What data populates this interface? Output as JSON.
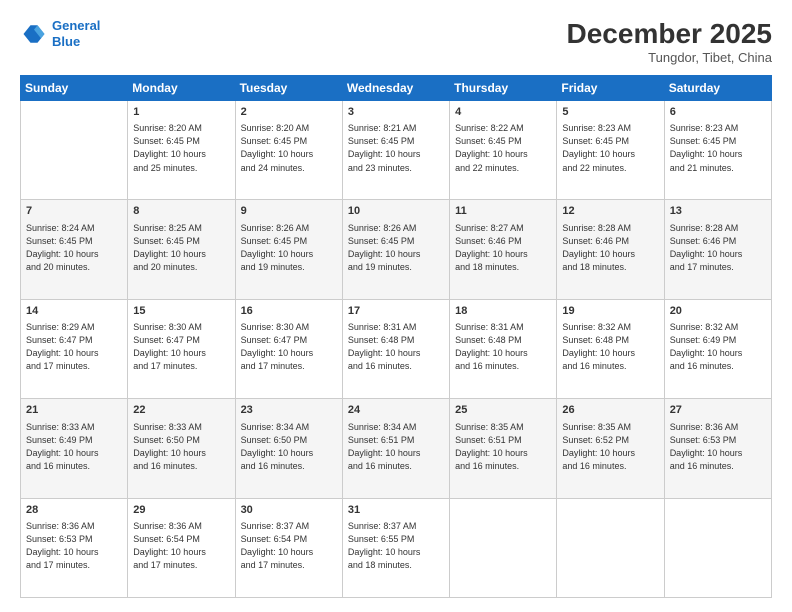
{
  "header": {
    "logo_line1": "General",
    "logo_line2": "Blue",
    "month": "December 2025",
    "location": "Tungdor, Tibet, China"
  },
  "days_of_week": [
    "Sunday",
    "Monday",
    "Tuesday",
    "Wednesday",
    "Thursday",
    "Friday",
    "Saturday"
  ],
  "weeks": [
    [
      {
        "day": "",
        "info": ""
      },
      {
        "day": "1",
        "info": "Sunrise: 8:20 AM\nSunset: 6:45 PM\nDaylight: 10 hours\nand 25 minutes."
      },
      {
        "day": "2",
        "info": "Sunrise: 8:20 AM\nSunset: 6:45 PM\nDaylight: 10 hours\nand 24 minutes."
      },
      {
        "day": "3",
        "info": "Sunrise: 8:21 AM\nSunset: 6:45 PM\nDaylight: 10 hours\nand 23 minutes."
      },
      {
        "day": "4",
        "info": "Sunrise: 8:22 AM\nSunset: 6:45 PM\nDaylight: 10 hours\nand 22 minutes."
      },
      {
        "day": "5",
        "info": "Sunrise: 8:23 AM\nSunset: 6:45 PM\nDaylight: 10 hours\nand 22 minutes."
      },
      {
        "day": "6",
        "info": "Sunrise: 8:23 AM\nSunset: 6:45 PM\nDaylight: 10 hours\nand 21 minutes."
      }
    ],
    [
      {
        "day": "7",
        "info": "Sunrise: 8:24 AM\nSunset: 6:45 PM\nDaylight: 10 hours\nand 20 minutes."
      },
      {
        "day": "8",
        "info": "Sunrise: 8:25 AM\nSunset: 6:45 PM\nDaylight: 10 hours\nand 20 minutes."
      },
      {
        "day": "9",
        "info": "Sunrise: 8:26 AM\nSunset: 6:45 PM\nDaylight: 10 hours\nand 19 minutes."
      },
      {
        "day": "10",
        "info": "Sunrise: 8:26 AM\nSunset: 6:45 PM\nDaylight: 10 hours\nand 19 minutes."
      },
      {
        "day": "11",
        "info": "Sunrise: 8:27 AM\nSunset: 6:46 PM\nDaylight: 10 hours\nand 18 minutes."
      },
      {
        "day": "12",
        "info": "Sunrise: 8:28 AM\nSunset: 6:46 PM\nDaylight: 10 hours\nand 18 minutes."
      },
      {
        "day": "13",
        "info": "Sunrise: 8:28 AM\nSunset: 6:46 PM\nDaylight: 10 hours\nand 17 minutes."
      }
    ],
    [
      {
        "day": "14",
        "info": "Sunrise: 8:29 AM\nSunset: 6:47 PM\nDaylight: 10 hours\nand 17 minutes."
      },
      {
        "day": "15",
        "info": "Sunrise: 8:30 AM\nSunset: 6:47 PM\nDaylight: 10 hours\nand 17 minutes."
      },
      {
        "day": "16",
        "info": "Sunrise: 8:30 AM\nSunset: 6:47 PM\nDaylight: 10 hours\nand 17 minutes."
      },
      {
        "day": "17",
        "info": "Sunrise: 8:31 AM\nSunset: 6:48 PM\nDaylight: 10 hours\nand 16 minutes."
      },
      {
        "day": "18",
        "info": "Sunrise: 8:31 AM\nSunset: 6:48 PM\nDaylight: 10 hours\nand 16 minutes."
      },
      {
        "day": "19",
        "info": "Sunrise: 8:32 AM\nSunset: 6:48 PM\nDaylight: 10 hours\nand 16 minutes."
      },
      {
        "day": "20",
        "info": "Sunrise: 8:32 AM\nSunset: 6:49 PM\nDaylight: 10 hours\nand 16 minutes."
      }
    ],
    [
      {
        "day": "21",
        "info": "Sunrise: 8:33 AM\nSunset: 6:49 PM\nDaylight: 10 hours\nand 16 minutes."
      },
      {
        "day": "22",
        "info": "Sunrise: 8:33 AM\nSunset: 6:50 PM\nDaylight: 10 hours\nand 16 minutes."
      },
      {
        "day": "23",
        "info": "Sunrise: 8:34 AM\nSunset: 6:50 PM\nDaylight: 10 hours\nand 16 minutes."
      },
      {
        "day": "24",
        "info": "Sunrise: 8:34 AM\nSunset: 6:51 PM\nDaylight: 10 hours\nand 16 minutes."
      },
      {
        "day": "25",
        "info": "Sunrise: 8:35 AM\nSunset: 6:51 PM\nDaylight: 10 hours\nand 16 minutes."
      },
      {
        "day": "26",
        "info": "Sunrise: 8:35 AM\nSunset: 6:52 PM\nDaylight: 10 hours\nand 16 minutes."
      },
      {
        "day": "27",
        "info": "Sunrise: 8:36 AM\nSunset: 6:53 PM\nDaylight: 10 hours\nand 16 minutes."
      }
    ],
    [
      {
        "day": "28",
        "info": "Sunrise: 8:36 AM\nSunset: 6:53 PM\nDaylight: 10 hours\nand 17 minutes."
      },
      {
        "day": "29",
        "info": "Sunrise: 8:36 AM\nSunset: 6:54 PM\nDaylight: 10 hours\nand 17 minutes."
      },
      {
        "day": "30",
        "info": "Sunrise: 8:37 AM\nSunset: 6:54 PM\nDaylight: 10 hours\nand 17 minutes."
      },
      {
        "day": "31",
        "info": "Sunrise: 8:37 AM\nSunset: 6:55 PM\nDaylight: 10 hours\nand 18 minutes."
      },
      {
        "day": "",
        "info": ""
      },
      {
        "day": "",
        "info": ""
      },
      {
        "day": "",
        "info": ""
      }
    ]
  ]
}
